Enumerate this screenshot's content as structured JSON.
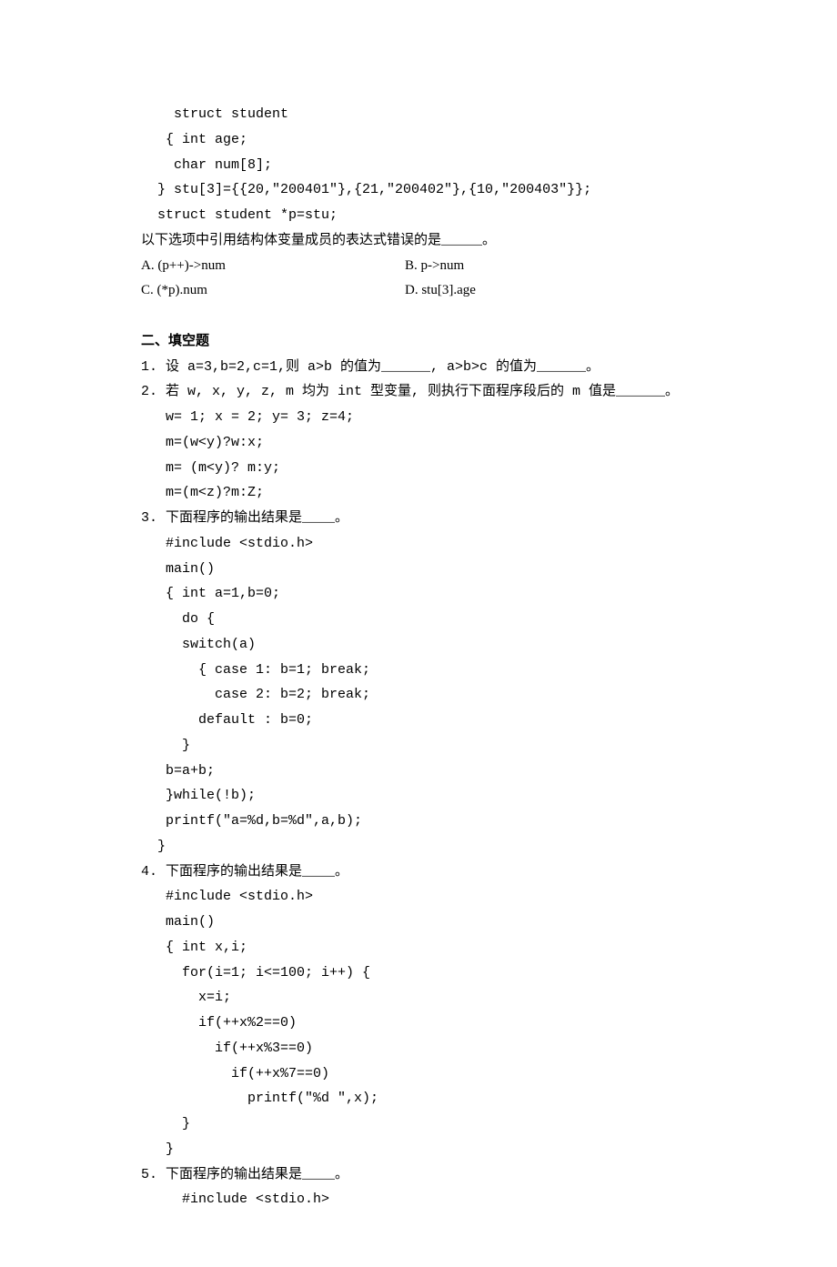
{
  "preamble": {
    "l1": "    struct student",
    "l2": "   { int age;",
    "l3": "    char num[8];",
    "l4": "  } stu[3]={{20,\"200401\"},{21,\"200402\"},{10,\"200403\"}};",
    "l5": "  struct student *p=stu;",
    "l6": "以下选项中引用结构体变量成员的表达式错误的是_____。",
    "opt_a": "A. (p++)->num",
    "opt_b": "B. p->num",
    "opt_c": "C. (*p).num",
    "opt_d": "D. stu[3].age"
  },
  "section2": {
    "title": "二、填空题",
    "q1": "1. 设 a=3,b=2,c=1,则 a>b 的值为______, a>b>c 的值为______。",
    "q2": {
      "l1": "2. 若 w, x, y, z, m 均为 int 型变量, 则执行下面程序段后的 m 值是______。",
      "l2": "   w= 1; x = 2; y= 3; z=4;",
      "l3": "   m=(w<y)?w:x;",
      "l4": "   m= (m<y)? m:y;",
      "l5": "   m=(m<z)?m:Z;"
    },
    "q3": {
      "l1": "3. 下面程序的输出结果是____。",
      "l2": "   #include <stdio.h>",
      "l3": "   main()",
      "l4": "   { int a=1,b=0;",
      "l5": "     do {",
      "l6": "     switch(a)",
      "l7": "       { case 1: b=1; break;",
      "l8": "         case 2: b=2; break;",
      "l9": "       default : b=0;",
      "l10": "     }",
      "l11": "   b=a+b;",
      "l12": "   }while(!b);",
      "l13": "   printf(\"a=%d,b=%d\",a,b);",
      "l14": "  }"
    },
    "q4": {
      "l1": "4. 下面程序的输出结果是____。",
      "l2": "   #include <stdio.h>",
      "l3": "   main()",
      "l4": "   { int x,i;",
      "l5": "     for(i=1; i<=100; i++) {",
      "l6": "       x=i;",
      "l7": "       if(++x%2==0)",
      "l8": "         if(++x%3==0)",
      "l9": "           if(++x%7==0)",
      "l10": "             printf(\"%d \",x);",
      "l11": "     }",
      "l12": "   }"
    },
    "q5": {
      "l1": "5. 下面程序的输出结果是____。",
      "l2": "     #include <stdio.h>"
    }
  }
}
